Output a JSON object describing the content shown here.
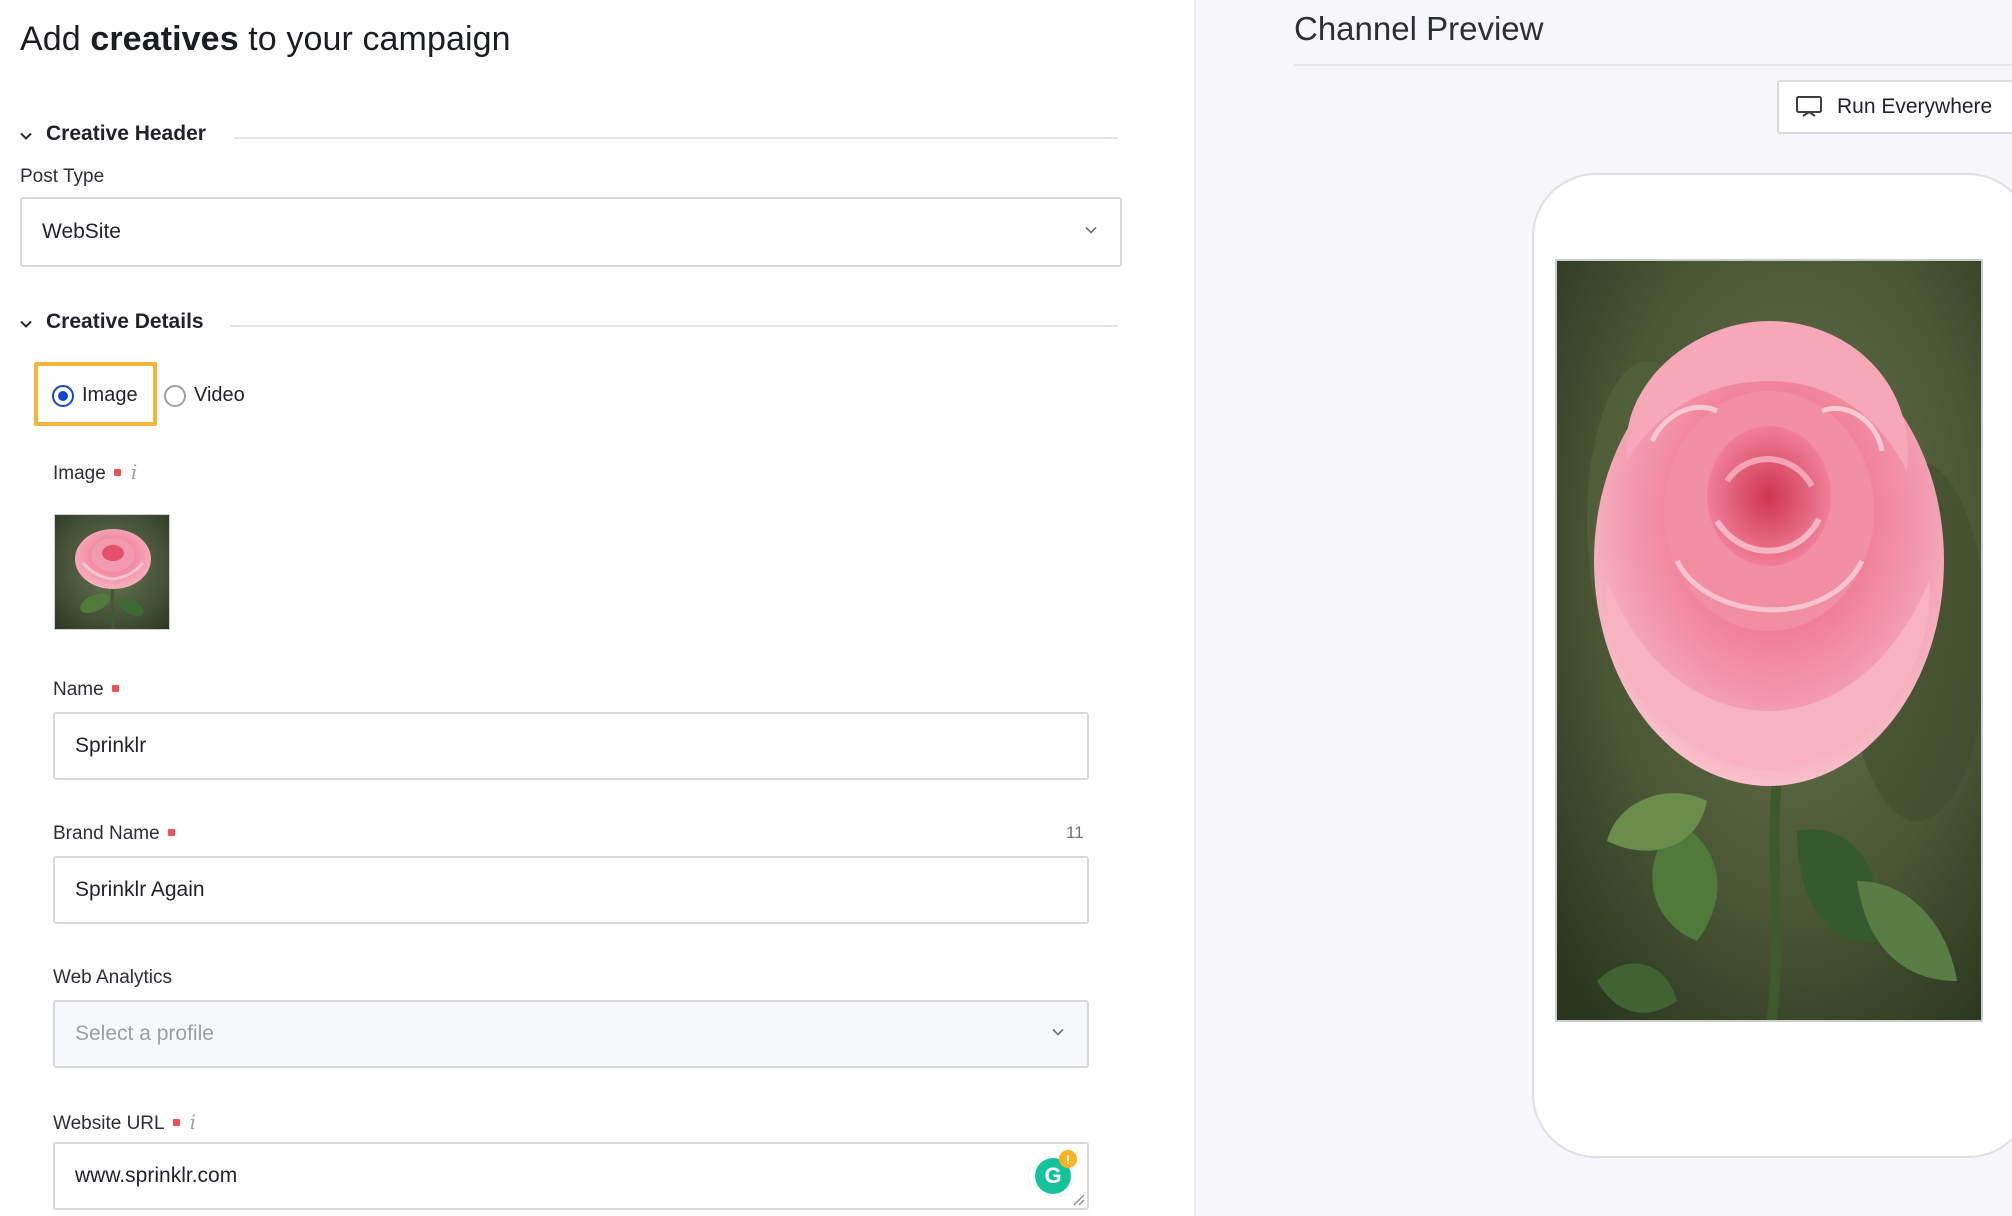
{
  "header": {
    "title_prefix": "Add ",
    "title_bold": "creatives",
    "title_suffix": " to your campaign"
  },
  "sections": {
    "creative_header": "Creative Header",
    "creative_details": "Creative Details"
  },
  "post_type": {
    "label": "Post Type",
    "value": "WebSite"
  },
  "media_type": {
    "options": [
      "Image",
      "Video"
    ],
    "selected": "Image"
  },
  "image_field": {
    "label": "Image",
    "info_glyph": "i",
    "thumbnail": "pink-rose"
  },
  "name_field": {
    "label": "Name",
    "value": "Sprinklr"
  },
  "brand_name_field": {
    "label": "Brand Name",
    "value": "Sprinklr Again",
    "counter": "11"
  },
  "web_analytics": {
    "label": "Web Analytics",
    "placeholder": "Select a profile"
  },
  "website_url": {
    "label": "Website URL",
    "info_glyph": "i",
    "value": "www.sprinklr.com",
    "grammarly_letter": "G",
    "grammarly_badge": "!"
  },
  "preview": {
    "title": "Channel Preview",
    "run_button": "Run Everywhere",
    "run_icon": "monitor-icon",
    "image": "pink-rose"
  },
  "colors": {
    "accent_blue": "#1347c9",
    "highlight_orange": "#f3b63b",
    "required_red": "#f05252",
    "grammarly_green": "#15c39a"
  }
}
